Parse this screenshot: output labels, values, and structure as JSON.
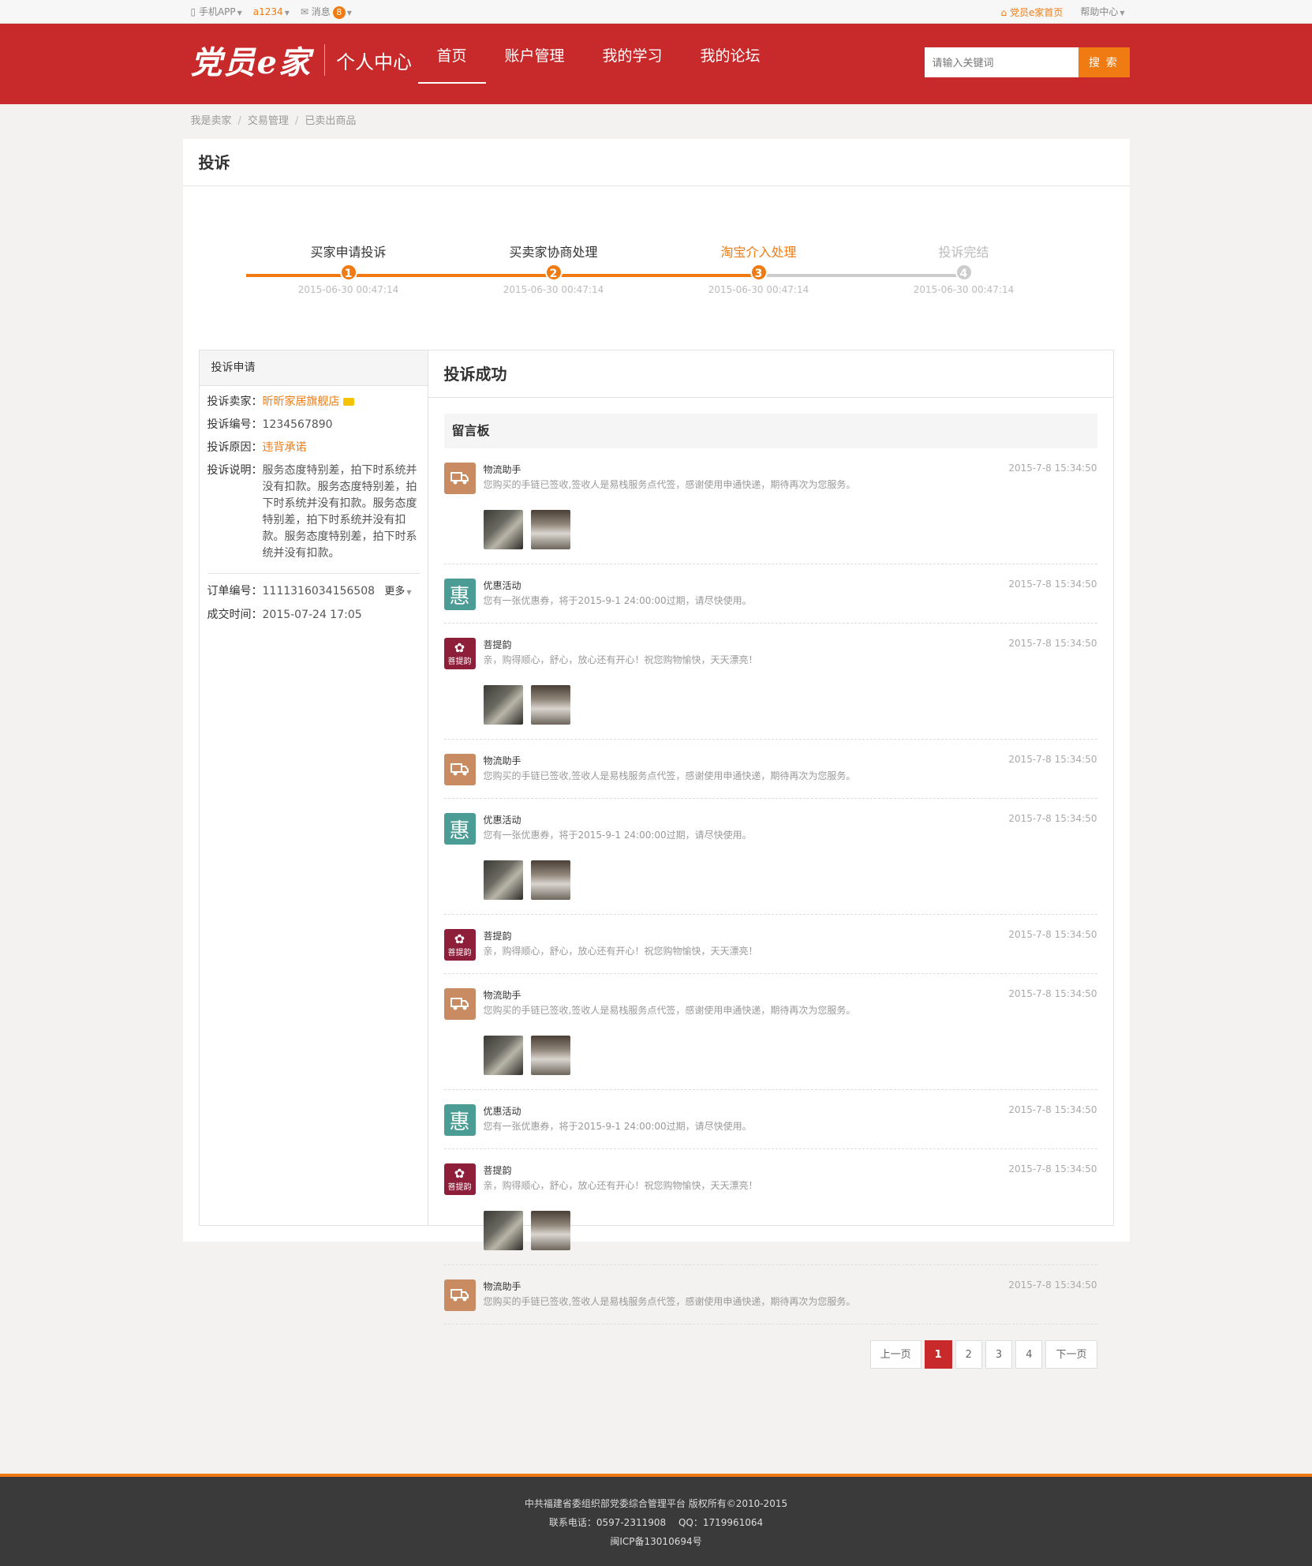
{
  "topbar": {
    "mobile_app": "手机APP",
    "user": "a1234",
    "messages_label": "消息",
    "messages_count": "8",
    "home_link": "党员e家首页",
    "help": "帮助中心"
  },
  "header": {
    "logo": "党员e家",
    "subtitle": "个人中心",
    "nav": [
      "首页",
      "账户管理",
      "我的学习",
      "我的论坛"
    ],
    "search_placeholder": "请输入关键词",
    "search_button": "搜 索"
  },
  "breadcrumb": [
    "我是卖家",
    "交易管理",
    "已卖出商品"
  ],
  "page_title": "投诉",
  "steps": [
    {
      "label": "买家申请投诉",
      "num": "1",
      "time": "2015-06-30 00:47:14"
    },
    {
      "label": "买卖家协商处理",
      "num": "2",
      "time": "2015-06-30 00:47:14"
    },
    {
      "label": "淘宝介入处理",
      "num": "3",
      "time": "2015-06-30 00:47:14"
    },
    {
      "label": "投诉完结",
      "num": "4",
      "time": "2015-06-30 00:47:14"
    }
  ],
  "side": {
    "title": "投诉申请",
    "seller_k": "投诉卖家：",
    "seller_v": "昕昕家居旗舰店",
    "no_k": "投诉编号：",
    "no_v": "1234567890",
    "reason_k": "投诉原因：",
    "reason_v": "违背承诺",
    "desc_k": "投诉说明：",
    "desc_v": "服务态度特别差，拍下时系统并没有扣款。服务态度特别差，拍下时系统并没有扣款。服务态度特别差，拍下时系统并没有扣款。服务态度特别差，拍下时系统并没有扣款。",
    "order_k": "订单编号：",
    "order_v": "1111316034156508",
    "more": "更多",
    "deal_k": "成交时间：",
    "deal_v": "2015-07-24 17:05"
  },
  "main": {
    "title": "投诉成功",
    "board_title": "留言板"
  },
  "messages": [
    {
      "type": "truck",
      "name": "物流助手",
      "text": "您购买的手链已签收,签收人是易栈服务点代签，感谢使用申通快递，期待再次为您服务。",
      "time": "2015-7-8 15:34:50",
      "pics": true
    },
    {
      "type": "hui",
      "name": "优惠活动",
      "text": "您有一张优惠券，将于2015-9-1 24:00:00过期，请尽快使用。",
      "time": "2015-7-8 15:34:50",
      "pics": false
    },
    {
      "type": "pu",
      "name": "菩提韵",
      "text": "亲，购得顺心，舒心，放心还有开心！祝您购物愉快，天天漂亮！",
      "time": "2015-7-8 15:34:50",
      "pics": true
    },
    {
      "type": "truck",
      "name": "物流助手",
      "text": "您购买的手链已签收,签收人是易栈服务点代签，感谢使用申通快递，期待再次为您服务。",
      "time": "2015-7-8 15:34:50",
      "pics": false
    },
    {
      "type": "hui",
      "name": "优惠活动",
      "text": "您有一张优惠券，将于2015-9-1 24:00:00过期，请尽快使用。",
      "time": "2015-7-8 15:34:50",
      "pics": true
    },
    {
      "type": "pu",
      "name": "菩提韵",
      "text": "亲，购得顺心，舒心，放心还有开心！祝您购物愉快，天天漂亮！",
      "time": "2015-7-8 15:34:50",
      "pics": false
    },
    {
      "type": "truck",
      "name": "物流助手",
      "text": "您购买的手链已签收,签收人是易栈服务点代签，感谢使用申通快递，期待再次为您服务。",
      "time": "2015-7-8 15:34:50",
      "pics": true
    },
    {
      "type": "hui",
      "name": "优惠活动",
      "text": "您有一张优惠券，将于2015-9-1 24:00:00过期，请尽快使用。",
      "time": "2015-7-8 15:34:50",
      "pics": false
    },
    {
      "type": "pu",
      "name": "菩提韵",
      "text": "亲，购得顺心，舒心，放心还有开心！祝您购物愉快，天天漂亮！",
      "time": "2015-7-8 15:34:50",
      "pics": true
    },
    {
      "type": "truck",
      "name": "物流助手",
      "text": "您购买的手链已签收,签收人是易栈服务点代签，感谢使用申通快递，期待再次为您服务。",
      "time": "2015-7-8 15:34:50",
      "pics": false
    }
  ],
  "avatar_text": {
    "hui": "惠",
    "pu": "菩提韵"
  },
  "pager": [
    "上一页",
    "1",
    "2",
    "3",
    "4",
    "下一页"
  ],
  "footer": {
    "line1": "中共福建省委组织部党委综合管理平台 版权所有©2010-2015",
    "line2": "联系电话：0597-2311908　 QQ：1719961064",
    "line3": "闽ICP备13010694号"
  },
  "colors": {
    "brand_red": "#c8292a",
    "accent_orange": "#f07b13",
    "inactive_gray": "#cccccc"
  }
}
